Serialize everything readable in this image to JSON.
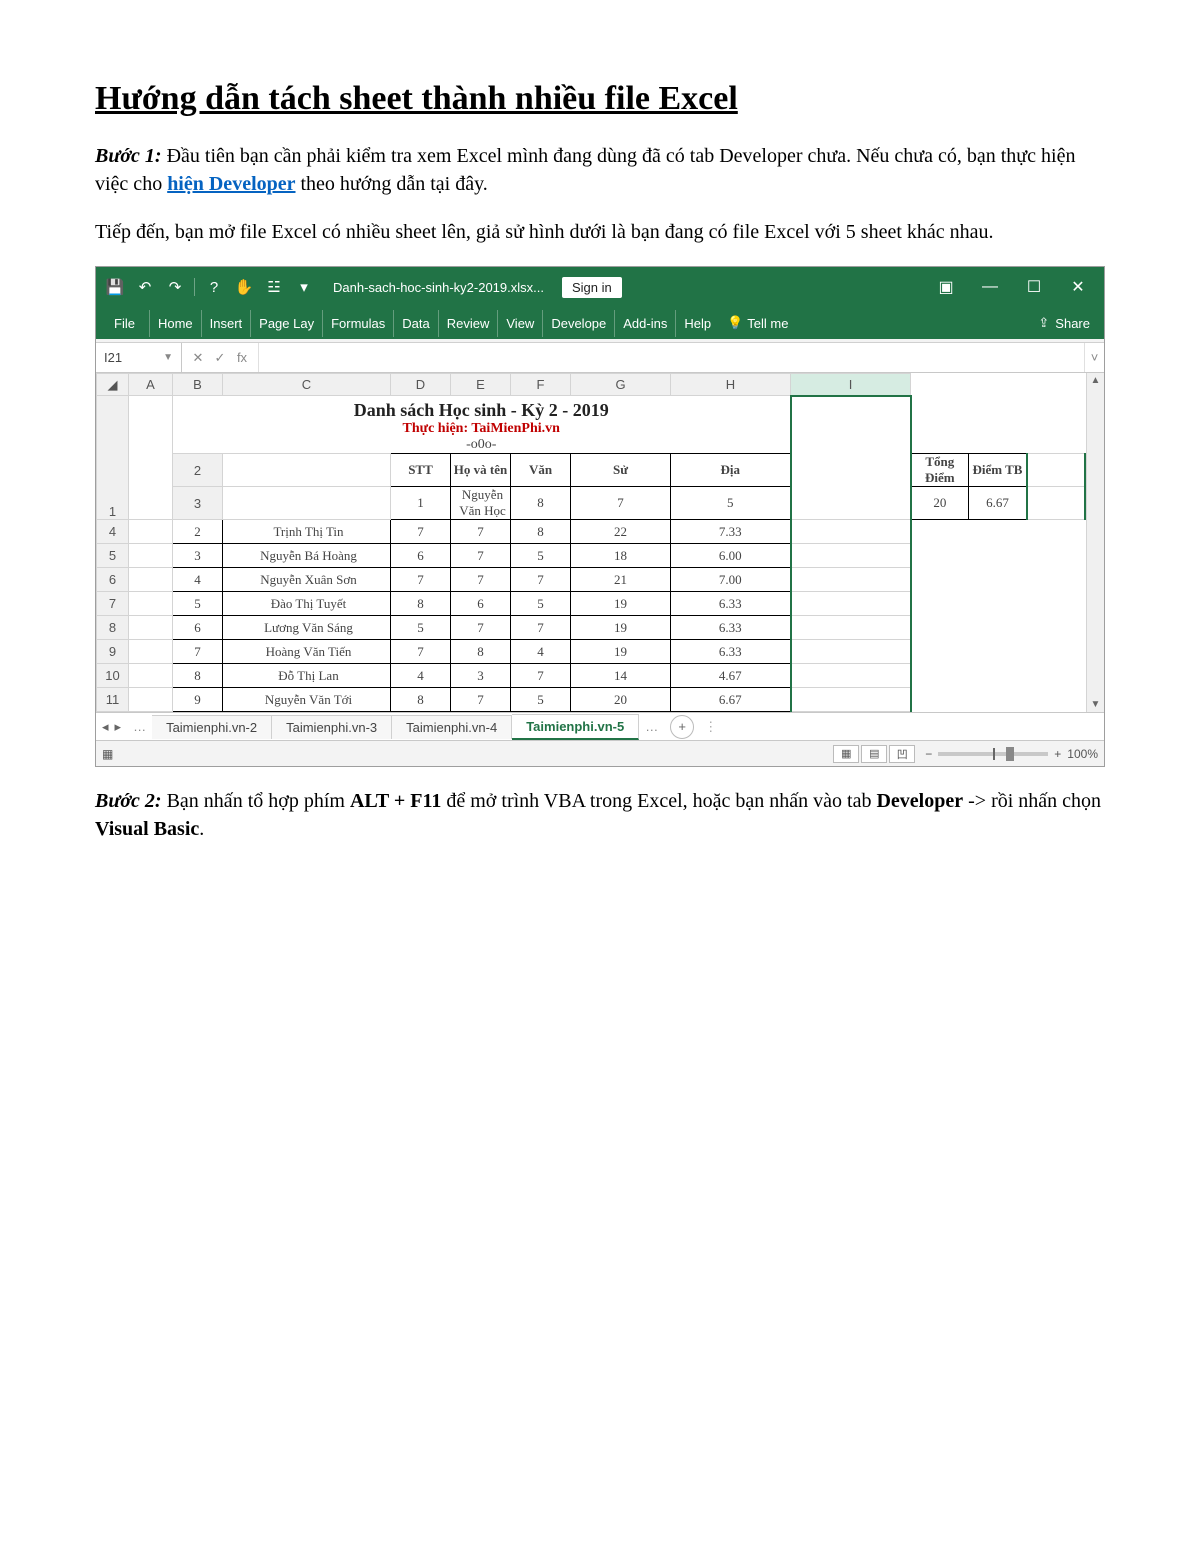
{
  "doc": {
    "title": "Hướng dẫn tách sheet thành nhiều file Excel",
    "step1_label": "Bước 1:",
    "step1_text_a": " Đầu tiên bạn cần phải kiểm tra xem Excel mình đang dùng đã có tab Developer chưa. Nếu chưa có, bạn thực hiện việc cho ",
    "step1_link": "hiện Developer",
    "step1_text_b": " theo hướng dẫn tại đây.",
    "para2": "Tiếp đến, bạn mở file Excel có nhiều sheet lên, giả sử hình dưới là bạn đang có file Excel với 5 sheet khác nhau.",
    "step2_label": "Bước 2:",
    "step2_text_a": " Bạn nhấn tổ hợp phím ",
    "step2_key": "ALT + F11",
    "step2_text_b": " để mở trình VBA trong Excel, hoặc bạn nhấn vào tab ",
    "step2_dev": "Developer",
    "step2_text_c": " -> rồi nhấn chọn ",
    "step2_vb": "Visual Basic",
    "step2_text_d": "."
  },
  "excel": {
    "filename": "Danh-sach-hoc-sinh-ky2-2019.xlsx...",
    "signin": "Sign in",
    "tabs": {
      "file": "File",
      "home": "Home",
      "insert": "Insert",
      "pagelayout": "Page Lay",
      "formulas": "Formulas",
      "data": "Data",
      "review": "Review",
      "view": "View",
      "developer": "Develope",
      "addins": "Add-ins",
      "help": "Help",
      "tellme": "Tell me",
      "share": "Share"
    },
    "namebox": "I21",
    "fx_label": "fx",
    "columns": [
      "A",
      "B",
      "C",
      "D",
      "E",
      "F",
      "G",
      "H",
      "I"
    ],
    "sheet_title": "Danh sách Học sinh - Kỳ 2 - 2019",
    "sheet_sub": "Thực hiện: TaiMienPhi.vn",
    "sheet_ooo": "-o0o-",
    "headers": [
      "STT",
      "Họ và tên",
      "Văn",
      "Sử",
      "Địa",
      "Tổng Điểm",
      "Điểm TB"
    ],
    "rows": [
      {
        "stt": "1",
        "name": "Nguyễn Văn Học",
        "van": "8",
        "su": "7",
        "dia": "5",
        "tong": "20",
        "tb": "6.67"
      },
      {
        "stt": "2",
        "name": "Trịnh Thị Tin",
        "van": "7",
        "su": "7",
        "dia": "8",
        "tong": "22",
        "tb": "7.33"
      },
      {
        "stt": "3",
        "name": "Nguyễn Bá Hoàng",
        "van": "6",
        "su": "7",
        "dia": "5",
        "tong": "18",
        "tb": "6.00"
      },
      {
        "stt": "4",
        "name": "Nguyễn Xuân Sơn",
        "van": "7",
        "su": "7",
        "dia": "7",
        "tong": "21",
        "tb": "7.00"
      },
      {
        "stt": "5",
        "name": "Đào Thị Tuyết",
        "van": "8",
        "su": "6",
        "dia": "5",
        "tong": "19",
        "tb": "6.33"
      },
      {
        "stt": "6",
        "name": "Lương Văn Sáng",
        "van": "5",
        "su": "7",
        "dia": "7",
        "tong": "19",
        "tb": "6.33"
      },
      {
        "stt": "7",
        "name": "Hoàng Văn Tiến",
        "van": "7",
        "su": "8",
        "dia": "4",
        "tong": "19",
        "tb": "6.33"
      },
      {
        "stt": "8",
        "name": "Đỗ Thị Lan",
        "van": "4",
        "su": "3",
        "dia": "7",
        "tong": "14",
        "tb": "4.67"
      },
      {
        "stt": "9",
        "name": "Nguyễn Văn Tới",
        "van": "8",
        "su": "7",
        "dia": "5",
        "tong": "20",
        "tb": "6.67"
      }
    ],
    "row_numbers": [
      "1",
      "2",
      "3",
      "4",
      "5",
      "6",
      "7",
      "8",
      "9",
      "10",
      "11"
    ],
    "sheet_tabs": [
      "Taimienphi.vn-2",
      "Taimienphi.vn-3",
      "Taimienphi.vn-4",
      "Taimienphi.vn-5"
    ],
    "active_tab": "Taimienphi.vn-5",
    "zoom": "100%"
  }
}
